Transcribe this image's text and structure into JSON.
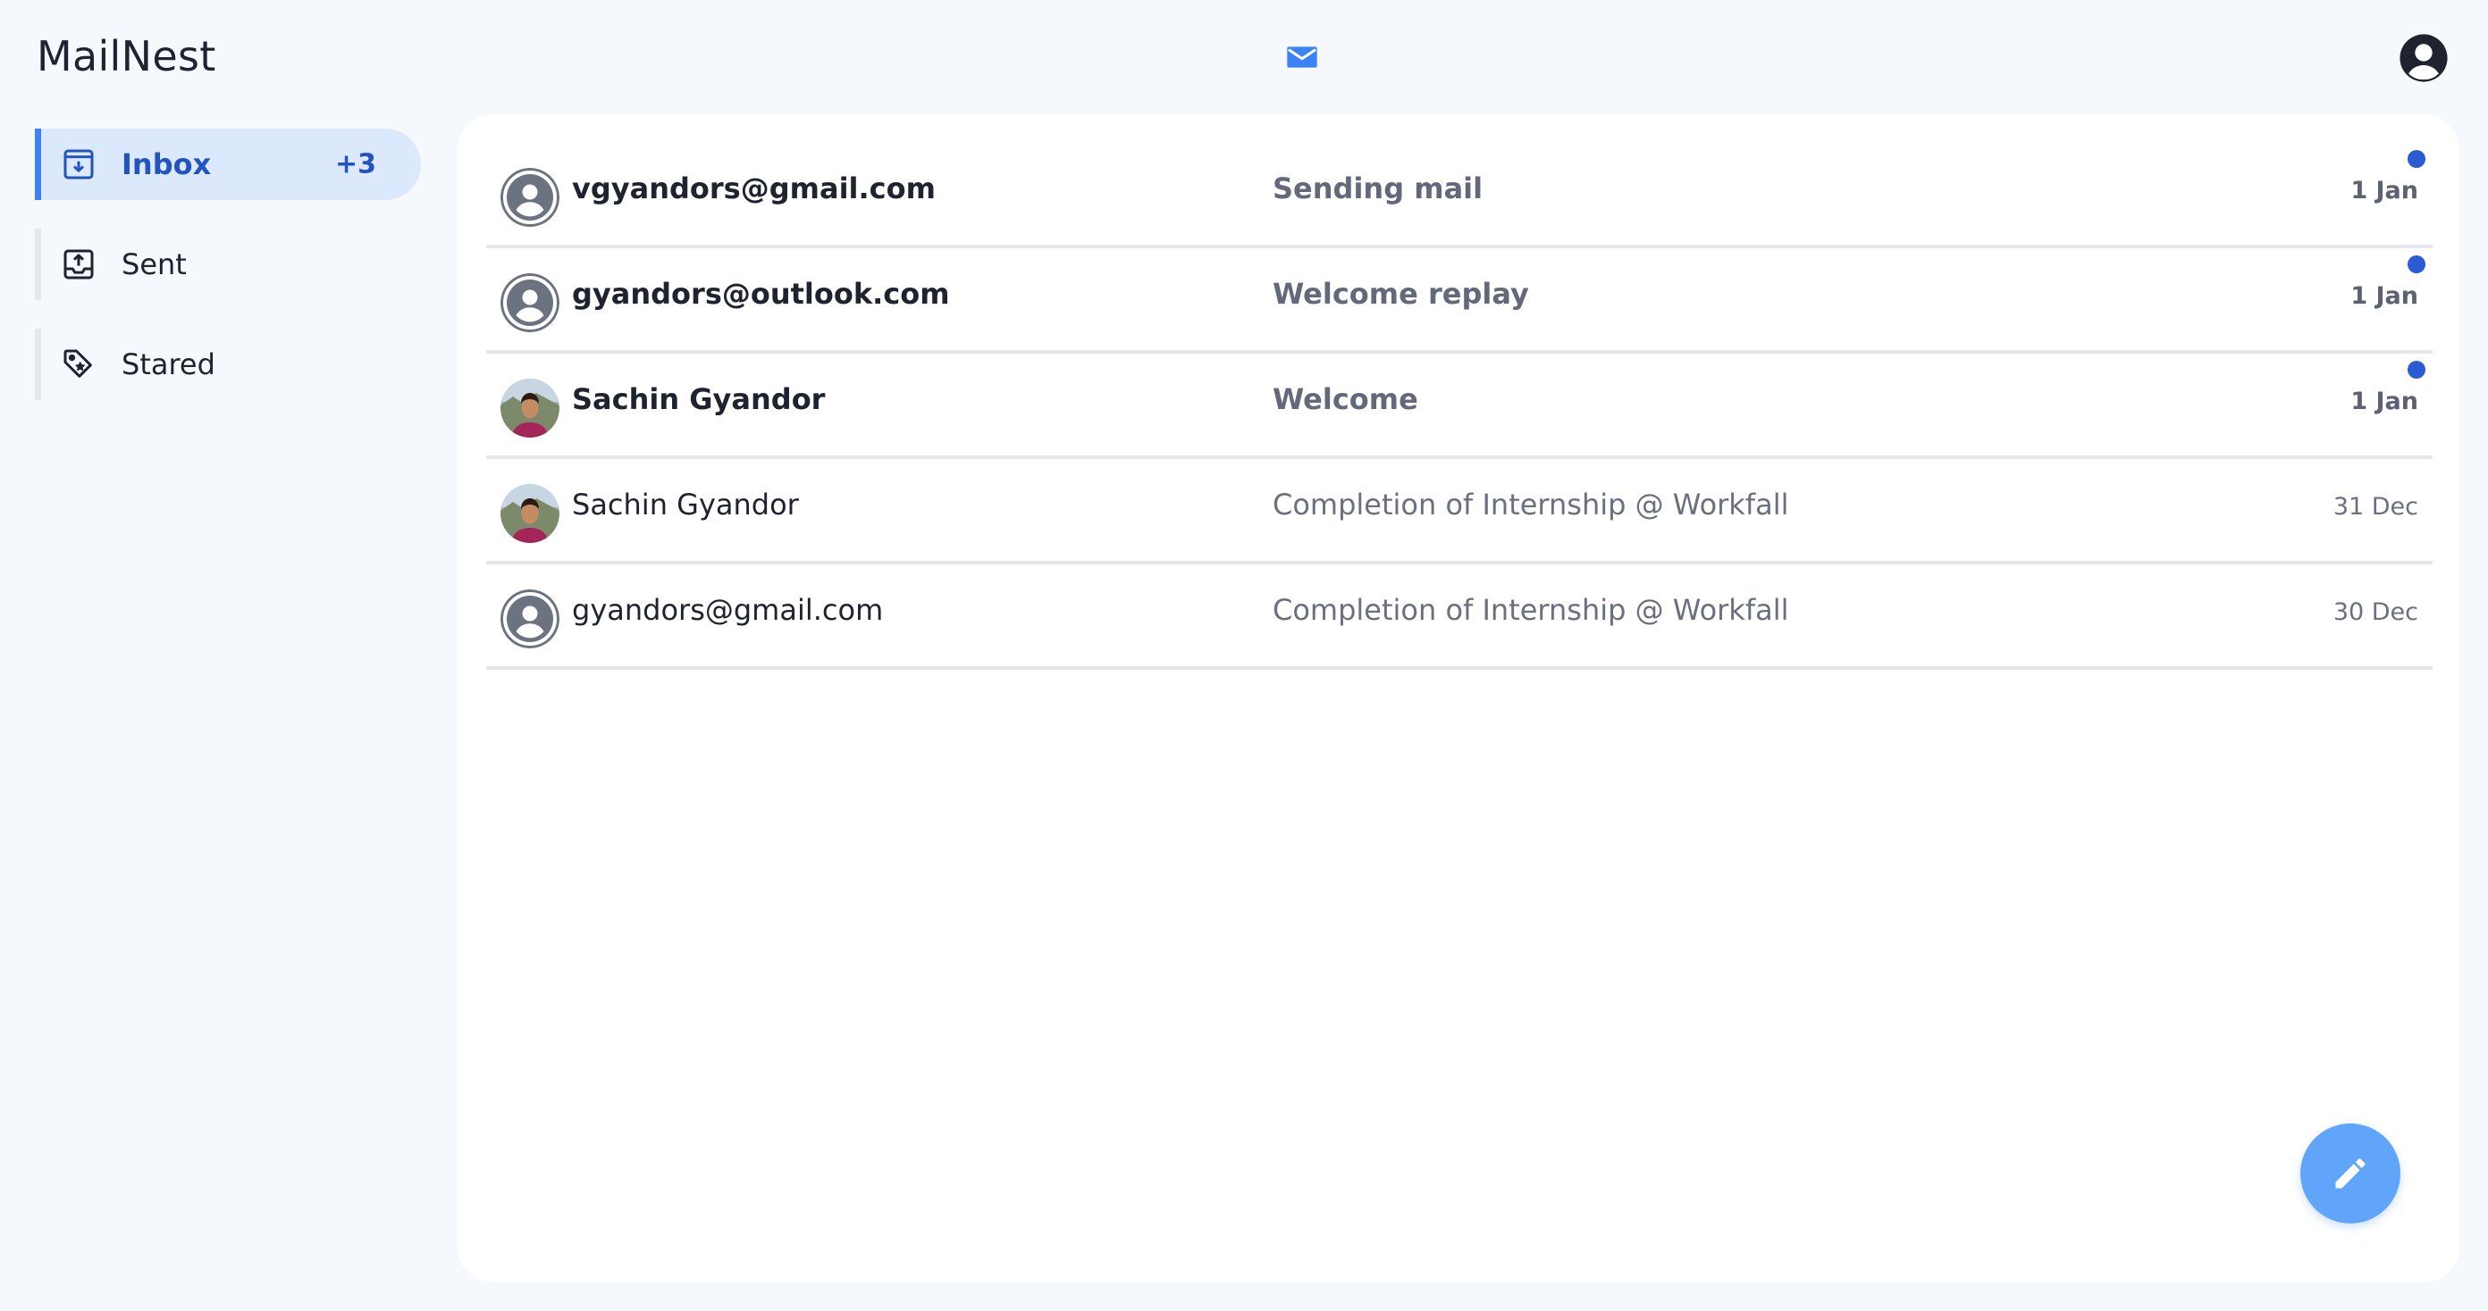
{
  "app": {
    "title": "MailNest"
  },
  "header": {
    "mail_icon": "mail-icon",
    "account_icon": "account-circle-icon"
  },
  "sidebar": {
    "accent_color": "#3b82f6",
    "items": [
      {
        "label": "Inbox",
        "badge": "+3",
        "icon": "inbox-icon",
        "active": true
      },
      {
        "label": "Sent",
        "icon": "sent-icon",
        "active": false
      },
      {
        "label": "Stared",
        "icon": "tag-icon",
        "active": false
      }
    ]
  },
  "emails": [
    {
      "sender": "vgyandors@gmail.com",
      "subject": "Sending mail",
      "date": "1 Jan",
      "unread": true,
      "avatar": "default-avatar-icon"
    },
    {
      "sender": "gyandors@outlook.com",
      "subject": "Welcome replay",
      "date": "1 Jan",
      "unread": true,
      "avatar": "default-avatar-icon"
    },
    {
      "sender": "Sachin Gyandor",
      "subject": "Welcome",
      "date": "1 Jan",
      "unread": true,
      "avatar": "photo-avatar"
    },
    {
      "sender": "Sachin Gyandor",
      "subject": "Completion of Internship @ Workfall",
      "date": "31 Dec",
      "unread": false,
      "avatar": "photo-avatar"
    },
    {
      "sender": "gyandors@gmail.com",
      "subject": "Completion of Internship @ Workfall",
      "date": "30 Dec",
      "unread": false,
      "avatar": "default-avatar-icon"
    }
  ],
  "colors": {
    "unread_dot": "#2b5bd2",
    "fab": "#60a5fa",
    "background": "#f5f8fc"
  },
  "compose": {
    "icon": "pencil-icon"
  }
}
